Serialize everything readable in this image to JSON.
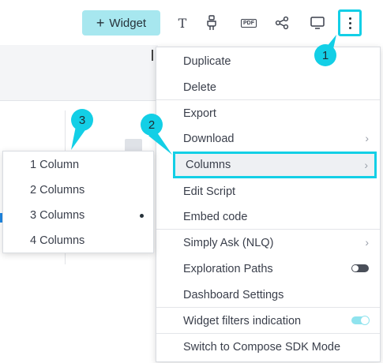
{
  "toolbar": {
    "widget_label": "Widget",
    "text_glyph": "T",
    "pdf_label": "PDF"
  },
  "menu": {
    "items": [
      {
        "label": "Duplicate"
      },
      {
        "label": "Delete"
      },
      {
        "label": "Export"
      },
      {
        "label": "Download"
      },
      {
        "label": "Columns"
      },
      {
        "label": "Edit Script"
      },
      {
        "label": "Embed code"
      },
      {
        "label": "Simply Ask (NLQ)"
      },
      {
        "label": "Exploration Paths",
        "toggle": "off"
      },
      {
        "label": "Dashboard Settings"
      },
      {
        "label": "Widget filters indication",
        "toggle": "on"
      },
      {
        "label": "Switch to Compose SDK Mode"
      }
    ]
  },
  "submenu": {
    "items": [
      {
        "label": "1 Column"
      },
      {
        "label": "2 Columns"
      },
      {
        "label": "3 Columns",
        "selected": true
      },
      {
        "label": "4 Columns"
      }
    ]
  },
  "callouts": [
    "1",
    "2",
    "3"
  ],
  "colors": {
    "accent": "#13cfe6",
    "widget_button": "#a7e7ef",
    "highlight_bg": "#eef0f3"
  },
  "icons": [
    "text-icon",
    "brush-icon",
    "pdf-icon",
    "share-icon",
    "monitor-icon",
    "more-vertical-icon"
  ]
}
